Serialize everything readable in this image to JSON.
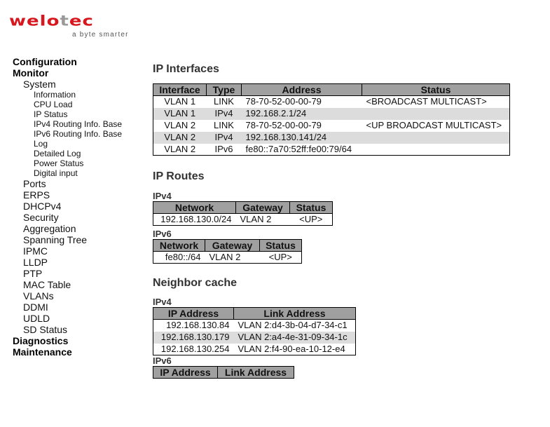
{
  "brand": {
    "name_left": "welo",
    "name_t": "T",
    "name_right": "ec",
    "tagline": "a byte smarter",
    "colors": {
      "primary": "#d7161e",
      "secondary": "#9a9a9a"
    }
  },
  "nav": {
    "items": [
      {
        "label": "Configuration",
        "level": 0
      },
      {
        "label": "Monitor",
        "level": 0
      },
      {
        "label": "System",
        "level": 1
      },
      {
        "label": "Information",
        "level": 2
      },
      {
        "label": "CPU Load",
        "level": 2
      },
      {
        "label": "IP Status",
        "level": 2
      },
      {
        "label": "IPv4 Routing Info. Base",
        "level": 2
      },
      {
        "label": "IPv6 Routing Info. Base",
        "level": 2
      },
      {
        "label": "Log",
        "level": 2
      },
      {
        "label": "Detailed Log",
        "level": 2
      },
      {
        "label": "Power Status",
        "level": 2
      },
      {
        "label": "Digital input",
        "level": 2
      },
      {
        "label": "Ports",
        "level": 1
      },
      {
        "label": "ERPS",
        "level": 1
      },
      {
        "label": "DHCPv4",
        "level": 1
      },
      {
        "label": "Security",
        "level": 1
      },
      {
        "label": "Aggregation",
        "level": 1
      },
      {
        "label": "Spanning Tree",
        "level": 1
      },
      {
        "label": "IPMC",
        "level": 1
      },
      {
        "label": "LLDP",
        "level": 1
      },
      {
        "label": "PTP",
        "level": 1
      },
      {
        "label": "MAC Table",
        "level": 1
      },
      {
        "label": "VLANs",
        "level": 1
      },
      {
        "label": "DDMI",
        "level": 1
      },
      {
        "label": "UDLD",
        "level": 1
      },
      {
        "label": "SD Status",
        "level": 1
      },
      {
        "label": "Diagnostics",
        "level": 0
      },
      {
        "label": "Maintenance",
        "level": 0
      }
    ]
  },
  "ip_interfaces": {
    "title": "IP Interfaces",
    "columns": [
      "Interface",
      "Type",
      "Address",
      "Status"
    ],
    "rows": [
      [
        "VLAN 1",
        "LINK",
        "78-70-52-00-00-79",
        "<BROADCAST MULTICAST>"
      ],
      [
        "VLAN 1",
        "IPv4",
        "192.168.2.1/24",
        ""
      ],
      [
        "VLAN 2",
        "LINK",
        "78-70-52-00-00-79",
        "<UP BROADCAST MULTICAST>"
      ],
      [
        "VLAN 2",
        "IPv4",
        "192.168.130.141/24",
        ""
      ],
      [
        "VLAN 2",
        "IPv6",
        "fe80::7a70:52ff:fe00:79/64",
        ""
      ]
    ]
  },
  "ip_routes": {
    "title": "IP Routes",
    "ipv4": {
      "label": "IPv4",
      "columns": [
        "Network",
        "Gateway",
        "Status"
      ],
      "rows": [
        [
          "192.168.130.0/24",
          "VLAN 2",
          "<UP>"
        ]
      ]
    },
    "ipv6": {
      "label": "IPv6",
      "columns": [
        "Network",
        "Gateway",
        "Status"
      ],
      "rows": [
        [
          "fe80::/64",
          "VLAN 2",
          "<UP>"
        ]
      ]
    }
  },
  "neighbor_cache": {
    "title": "Neighbor cache",
    "ipv4": {
      "label": "IPv4",
      "columns": [
        "IP Address",
        "Link Address"
      ],
      "rows": [
        [
          "192.168.130.84",
          "VLAN 2:d4-3b-04-d7-34-c1"
        ],
        [
          "192.168.130.179",
          "VLAN 2:a4-4e-31-09-34-1c"
        ],
        [
          "192.168.130.254",
          "VLAN 2:f4-90-ea-10-12-e4"
        ]
      ]
    },
    "ipv6": {
      "label": "IPv6",
      "columns": [
        "IP Address",
        "Link Address"
      ],
      "rows": []
    }
  }
}
